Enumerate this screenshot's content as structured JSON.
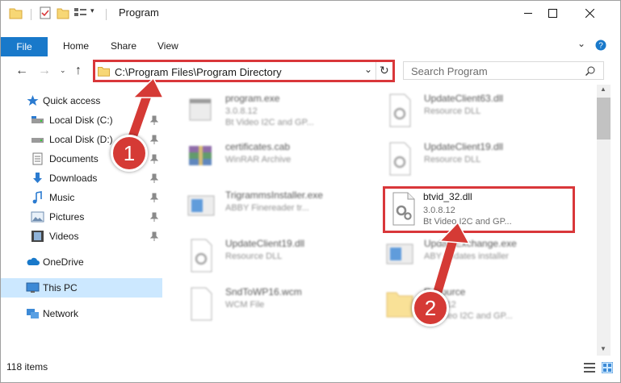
{
  "window": {
    "title": "Program",
    "minimize_icon": "minimize-icon",
    "maximize_icon": "maximize-icon",
    "close_icon": "close-icon"
  },
  "ribbon": {
    "tabs": [
      "File",
      "Home",
      "Share",
      "View"
    ],
    "help_icon": "help-icon"
  },
  "address": {
    "path": "C:\\Program Files\\Program Directory",
    "search_placeholder": "Search Program"
  },
  "sidebar": {
    "items": [
      {
        "label": "Quick access",
        "icon": "star-icon"
      },
      {
        "label": "Local Disk (C:)",
        "icon": "drive-icon",
        "pinned": true
      },
      {
        "label": "Local Disk (D:)",
        "icon": "drive-icon",
        "pinned": true
      },
      {
        "label": "Documents",
        "icon": "documents-icon",
        "pinned": true
      },
      {
        "label": "Downloads",
        "icon": "download-icon",
        "pinned": true
      },
      {
        "label": "Music",
        "icon": "music-icon",
        "pinned": true
      },
      {
        "label": "Pictures",
        "icon": "pictures-icon",
        "pinned": true
      },
      {
        "label": "Videos",
        "icon": "videos-icon",
        "pinned": true
      },
      {
        "label": "OneDrive",
        "icon": "cloud-icon"
      },
      {
        "label": "This PC",
        "icon": "computer-icon",
        "selected": true
      },
      {
        "label": "Network",
        "icon": "network-icon"
      }
    ]
  },
  "files": [
    {
      "name": "program.exe",
      "version": "3.0.8.12",
      "desc": "Bt Video I2C and GP...",
      "icon": "exe-icon"
    },
    {
      "name": "UpdateClient63.dll",
      "version": "",
      "desc": "Resource DLL",
      "icon": "dll-icon"
    },
    {
      "name": "certificates.cab",
      "version": "",
      "desc": "WinRAR Archive",
      "icon": "archive-icon"
    },
    {
      "name": "UpdateClient19.dll",
      "version": "",
      "desc": "Resource DLL",
      "icon": "dll-icon"
    },
    {
      "name": "TrigrammsInstaller.exe",
      "version": "",
      "desc": "ABBY Finereader tr...",
      "icon": "installer-icon"
    },
    {
      "name": "btvid_32.dll",
      "version": "3.0.8.12",
      "desc": "Bt Video I2C and GP...",
      "icon": "dll-gear-icon"
    },
    {
      "name": "UpdateClient19.dll",
      "version": "",
      "desc": "Resource DLL",
      "icon": "dll-icon"
    },
    {
      "name": "UpdateExchange.exe",
      "version": "",
      "desc": "ABY updates installer",
      "icon": "installer-icon"
    },
    {
      "name": "SndToWP16.wcm",
      "version": "",
      "desc": "WCM File",
      "icon": "file-icon"
    },
    {
      "name": "Resource",
      "version": "3.0.8.12",
      "desc": "Bt Video I2C and GP...",
      "icon": "folder-icon"
    }
  ],
  "status": {
    "items": "118 items"
  },
  "annotations": {
    "step1": "1",
    "step2": "2"
  },
  "colors": {
    "accent": "#1979ca",
    "highlight": "#d9373a",
    "selection": "#cce8ff"
  }
}
